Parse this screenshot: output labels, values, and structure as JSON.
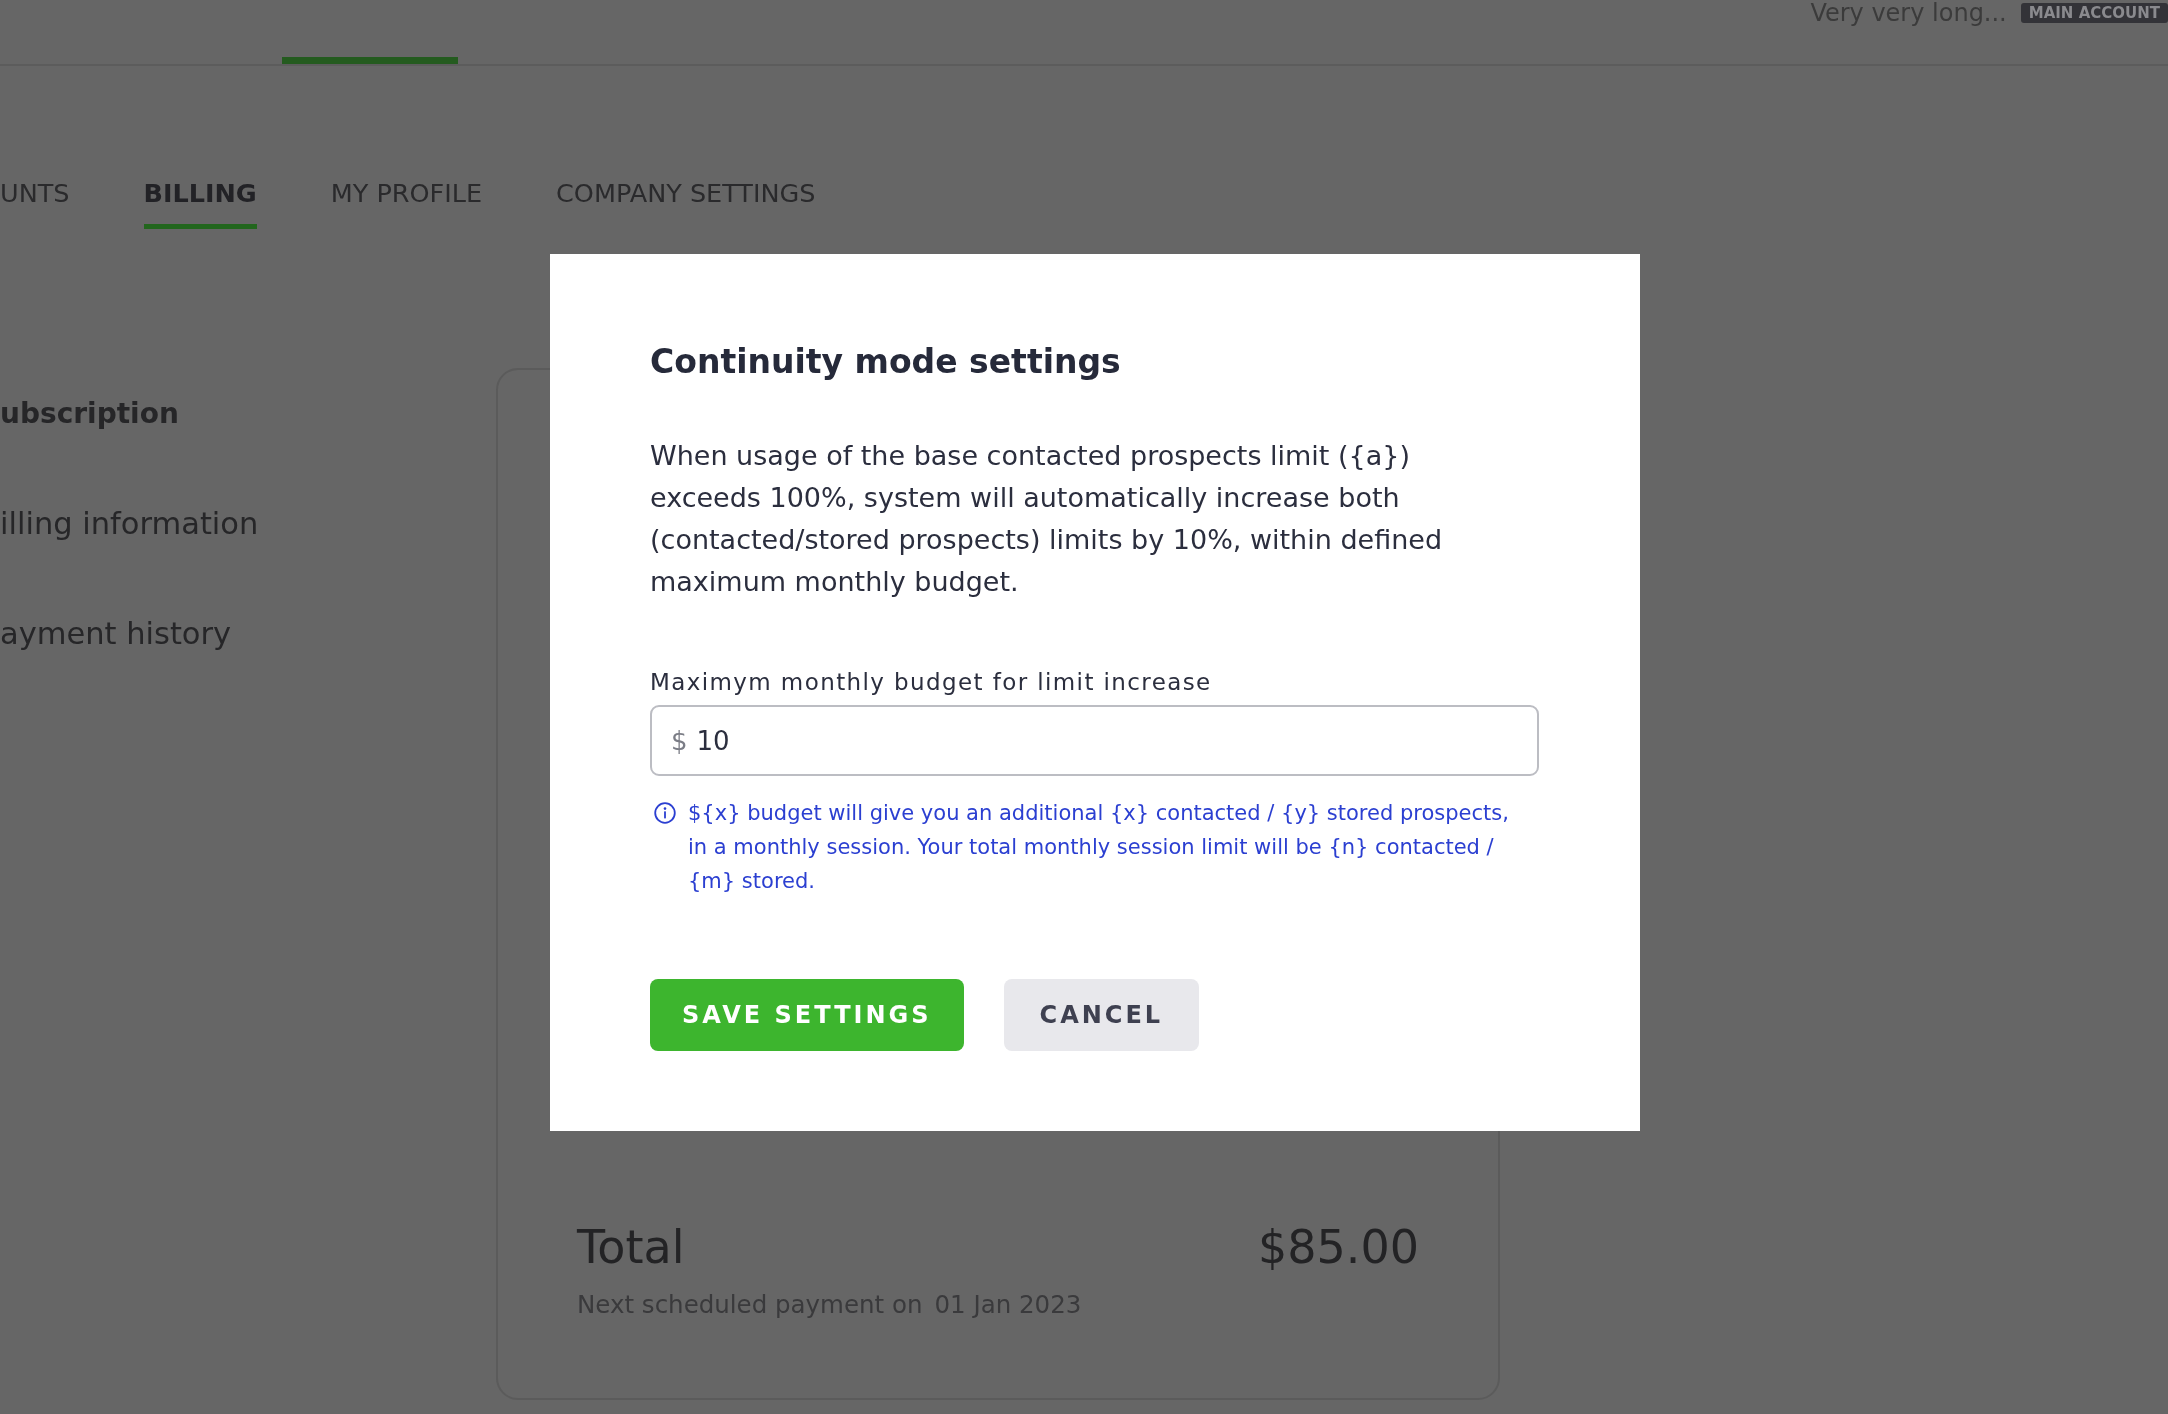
{
  "top_bar": {
    "user_name": "Very very long...",
    "account_badge": "MAIN ACCOUNT"
  },
  "tabs": [
    {
      "label": "UNTS",
      "selected": false
    },
    {
      "label": "BILLING",
      "selected": true
    },
    {
      "label": "MY PROFILE",
      "selected": false
    },
    {
      "label": "COMPANY SETTINGS",
      "selected": false
    }
  ],
  "sidebar": {
    "items": [
      {
        "label": "ubscription",
        "selected": true
      },
      {
        "label": "illing information",
        "selected": false
      },
      {
        "label": "ayment history",
        "selected": false
      }
    ]
  },
  "summary_card": {
    "total_label": "Total",
    "total_amount": "$85.00",
    "next_payment_label": "Next scheduled payment on",
    "next_payment_date": "01 Jan 2023"
  },
  "dialog": {
    "title": "Continuity mode settings",
    "description": "When usage of the base contacted prospects limit ({a}) exceeds 100%, system will automatically increase both (contacted/stored prospects) limits by 10%, within defined maximum monthly budget.",
    "budget_field": {
      "label": "Maximym monthly budget for limit increase",
      "prefix": "$",
      "value": "10"
    },
    "hint": "${x} budget will give you an additional {x} contacted / {y} stored prospects, in a monthly session. Your total monthly session limit will be {n} contacted / {m} stored.",
    "buttons": [
      {
        "label": "SAVE SETTINGS",
        "kind": "primary"
      },
      {
        "label": "CANCEL",
        "kind": "secondary"
      }
    ]
  }
}
